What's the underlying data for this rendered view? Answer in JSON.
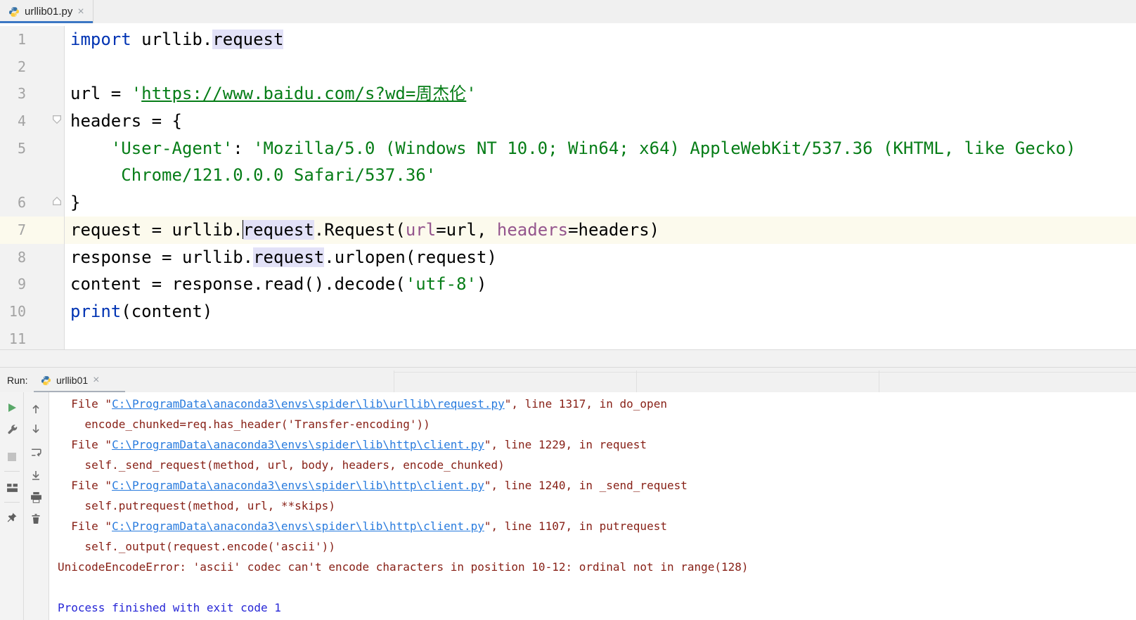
{
  "editor_tab": {
    "label": "urllib01.py",
    "close_glyph": "×"
  },
  "code": {
    "rows": [
      {
        "n": "1",
        "segs": [
          {
            "t": "import",
            "c": "kw"
          },
          {
            "t": " urllib.",
            "c": "pl"
          },
          {
            "t": "request",
            "c": "hl"
          }
        ]
      },
      {
        "n": "2",
        "segs": []
      },
      {
        "n": "3",
        "segs": [
          {
            "t": "url = ",
            "c": "pl"
          },
          {
            "t": "'",
            "c": "str"
          },
          {
            "t": "https://www.baidu.com/s?wd=周杰伦",
            "c": "strU"
          },
          {
            "t": "'",
            "c": "str"
          }
        ]
      },
      {
        "n": "4",
        "fold": "down",
        "segs": [
          {
            "t": "headers = {",
            "c": "pl"
          }
        ]
      },
      {
        "n": "5",
        "segs": [
          {
            "t": "    ",
            "c": "pl"
          },
          {
            "t": "'User-Agent'",
            "c": "str"
          },
          {
            "t": ": ",
            "c": "pl"
          },
          {
            "t": "'Mozilla/5.0 (Windows NT 10.0; Win64; x64) AppleWebKit/537.36 (KHTML, like Gecko)",
            "c": "str"
          }
        ]
      },
      {
        "n": "",
        "segs": [
          {
            "t": "     ",
            "c": "pl"
          },
          {
            "t": "Chrome/121.0.0.0 Safari/537.36'",
            "c": "str"
          }
        ]
      },
      {
        "n": "6",
        "fold": "up",
        "segs": [
          {
            "t": "}",
            "c": "pl"
          }
        ]
      },
      {
        "n": "7",
        "cur": true,
        "segs": [
          {
            "t": "request = urllib.",
            "c": "pl"
          },
          {
            "caret": true,
            "t": ""
          },
          {
            "t": "request",
            "c": "hl"
          },
          {
            "t": ".Request(",
            "c": "pl"
          },
          {
            "t": "url",
            "c": "arg"
          },
          {
            "t": "=url, ",
            "c": "pl"
          },
          {
            "t": "headers",
            "c": "arg"
          },
          {
            "t": "=headers)",
            "c": "pl"
          }
        ]
      },
      {
        "n": "8",
        "segs": [
          {
            "t": "response = urllib.",
            "c": "pl"
          },
          {
            "t": "request",
            "c": "hl"
          },
          {
            "t": ".urlopen(request)",
            "c": "pl"
          }
        ]
      },
      {
        "n": "9",
        "segs": [
          {
            "t": "content = response.read().decode(",
            "c": "pl"
          },
          {
            "t": "'utf-8'",
            "c": "str"
          },
          {
            "t": ")",
            "c": "pl"
          }
        ]
      },
      {
        "n": "10",
        "segs": [
          {
            "t": "print",
            "c": "kw"
          },
          {
            "t": "(content)",
            "c": "pl"
          }
        ]
      },
      {
        "n": "11",
        "segs": []
      }
    ]
  },
  "run_panel": {
    "label": "Run:",
    "tab_label": "urllib01",
    "close_glyph": "×",
    "toolbar_icons": [
      "rerun",
      "settings",
      "stop",
      "restore-layout",
      "pin",
      "up",
      "down",
      "soft-wrap",
      "scroll-to-end",
      "print",
      "clear-all"
    ],
    "console_rows": [
      {
        "segs": [
          {
            "t": "  File \"",
            "c": "err"
          },
          {
            "t": "C:\\ProgramData\\anaconda3\\envs\\spider\\lib\\urllib\\request.py",
            "c": "link"
          },
          {
            "t": "\", line 1317, in do_open",
            "c": "err"
          }
        ]
      },
      {
        "segs": [
          {
            "t": "    encode_chunked=req.has_header('Transfer-encoding'))",
            "c": "err"
          }
        ]
      },
      {
        "segs": [
          {
            "t": "  File \"",
            "c": "err"
          },
          {
            "t": "C:\\ProgramData\\anaconda3\\envs\\spider\\lib\\http\\client.py",
            "c": "link"
          },
          {
            "t": "\", line 1229, in request",
            "c": "err"
          }
        ]
      },
      {
        "segs": [
          {
            "t": "    self._send_request(method, url, body, headers, encode_chunked)",
            "c": "err"
          }
        ]
      },
      {
        "segs": [
          {
            "t": "  File \"",
            "c": "err"
          },
          {
            "t": "C:\\ProgramData\\anaconda3\\envs\\spider\\lib\\http\\client.py",
            "c": "link"
          },
          {
            "t": "\", line 1240, in _send_request",
            "c": "err"
          }
        ]
      },
      {
        "segs": [
          {
            "t": "    self.putrequest(method, url, **skips)",
            "c": "err"
          }
        ]
      },
      {
        "segs": [
          {
            "t": "  File \"",
            "c": "err"
          },
          {
            "t": "C:\\ProgramData\\anaconda3\\envs\\spider\\lib\\http\\client.py",
            "c": "link"
          },
          {
            "t": "\", line 1107, in putrequest",
            "c": "err"
          }
        ]
      },
      {
        "segs": [
          {
            "t": "    self._output(request.encode('ascii'))",
            "c": "err"
          }
        ]
      },
      {
        "segs": [
          {
            "t": "UnicodeEncodeError: 'ascii' codec can't encode characters in position 10-12: ordinal not in range(128)",
            "c": "err"
          }
        ]
      },
      {
        "segs": []
      },
      {
        "segs": [
          {
            "t": "Process finished with exit code 1",
            "c": "sys"
          }
        ]
      }
    ]
  },
  "colors": {
    "accent_tab_blue": "#3c77c4",
    "keyword_blue": "#0033b3",
    "string_green": "#067d17",
    "named_arg_purple": "#94558d",
    "caret_row_yellow": "#fcfaed",
    "identifier_highlight": "#e2e1f7",
    "error_red": "#871f15",
    "link_blue": "#287bde",
    "system_blue": "#2626d6",
    "run_tab_underline_gray": "#a9b0ba",
    "play_green": "#59a869"
  }
}
